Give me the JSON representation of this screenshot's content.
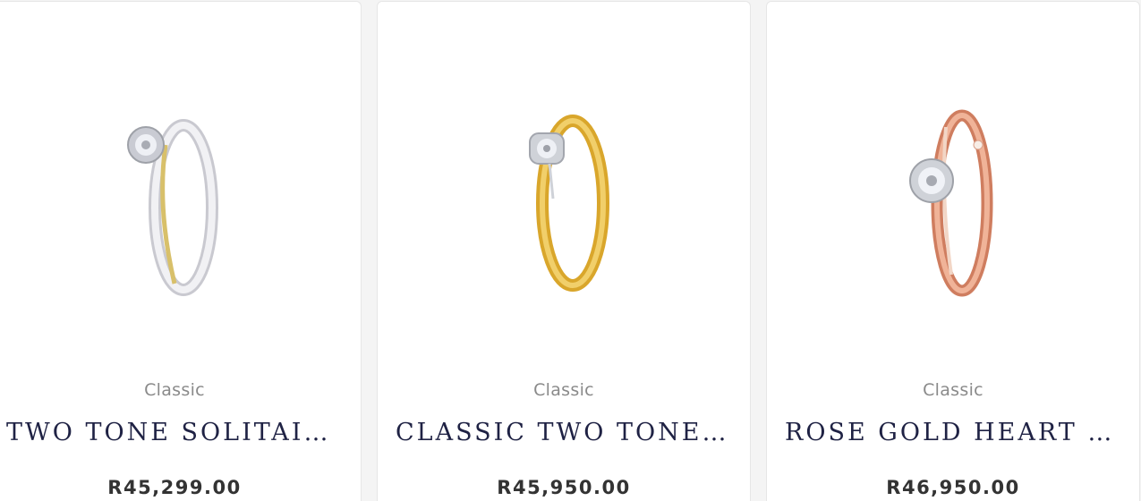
{
  "products": [
    {
      "category": "Classic",
      "title": "TWO TONE SOLITAIRE",
      "price": "R45,299.00",
      "image_icon": "two-tone-solitaire-ring-image",
      "band_color": "#e8e8ec",
      "accent_color": "#d8c06a"
    },
    {
      "category": "Classic",
      "title": "CLASSIC TWO TONE SOLITAIRE",
      "price": "R45,950.00",
      "image_icon": "classic-two-tone-ring-image",
      "band_color": "#e6b63d",
      "accent_color": "#cfd2d8"
    },
    {
      "category": "Classic",
      "title": "ROSE GOLD HEART SOLITAIRE",
      "price": "R46,950.00",
      "image_icon": "rose-gold-heart-ring-image",
      "band_color": "#e2967a",
      "accent_color": "#f2d6c6"
    }
  ]
}
